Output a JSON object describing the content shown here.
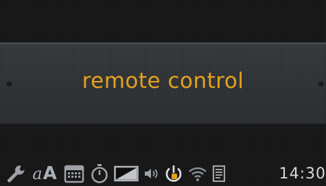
{
  "message": {
    "text": "remote control"
  },
  "status_bar": {
    "icons": [
      "wrench-icon",
      "font-size-icon",
      "calendar-icon",
      "stopwatch-icon",
      "brightness-icon",
      "volume-icon",
      "power-icon",
      "wifi-icon",
      "document-icon"
    ],
    "font_icon_small": "a",
    "font_icon_large": "A",
    "time": "14:30"
  },
  "colors": {
    "message_text": "#e5a21f",
    "power_accent": "#e5a21f",
    "icon_gray": "#9ea2a6"
  }
}
